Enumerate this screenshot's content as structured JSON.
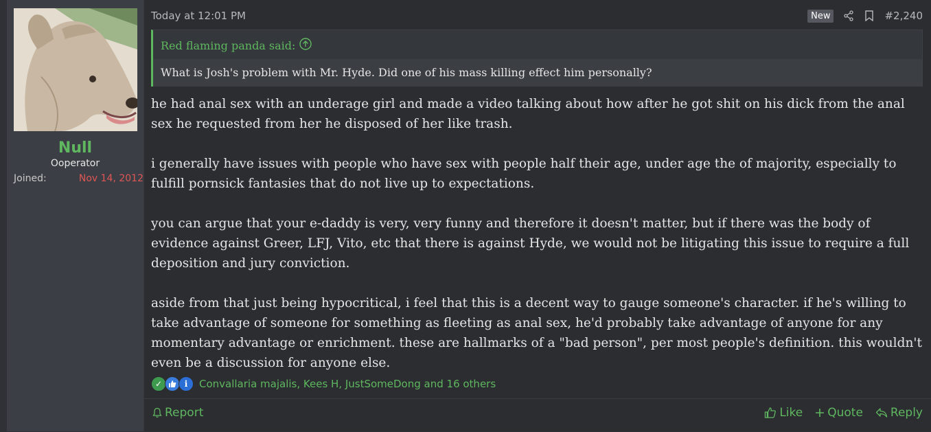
{
  "user": {
    "name": "Null",
    "title": "Ooperator",
    "joined_label": "Joined:",
    "joined_date": "Nov 14, 2012",
    "avatar_icon": "dog-avatar"
  },
  "post": {
    "timestamp": "Today at 12:01 PM",
    "new_badge": "New",
    "number": "#2,240",
    "share_icon": "share-icon",
    "bookmark_icon": "bookmark-icon"
  },
  "quote": {
    "author_line": "Red flaming panda said:",
    "text": "What is Josh's problem with Mr. Hyde. Did one of his mass killing effect him personally?"
  },
  "body": {
    "paragraphs": [
      "he had anal sex with an underage girl and made a video talking about how after he got shit on his dick from the anal sex he requested from her he disposed of her like trash.",
      "i generally have issues with people who have sex with people half their age, under age the of majority, especially to fulfill pornsick fantasies that do not live up to expectations.",
      "you can argue that your e-daddy is very, very funny and therefore it doesn't matter, but if there was the body of evidence against Greer, LFJ, Vito, etc that there is against Hyde, we would not be litigating this issue to require a full deposition and jury conviction.",
      "aside from that just being hypocritical, i feel that this is a decent way to gauge someone's character. if he's willing to take advantage of someone for something as fleeting as anal sex, he'd probably take advantage of anyone for any momentary advantage or enrichment. these are hallmarks of a \"bad person\", per most people's definition. this wouldn't even be a discussion for anyone else."
    ]
  },
  "reactions": {
    "users": "Convallaria majalis, Kees H, JustSomeDong and 16 others",
    "info_glyph": "i"
  },
  "actions": {
    "report": "Report",
    "like": "Like",
    "quote": "Quote",
    "reply": "Reply"
  },
  "colors": {
    "accent_green": "#5fb75f",
    "joined_red": "#e05555",
    "background": "#2b2d31"
  }
}
